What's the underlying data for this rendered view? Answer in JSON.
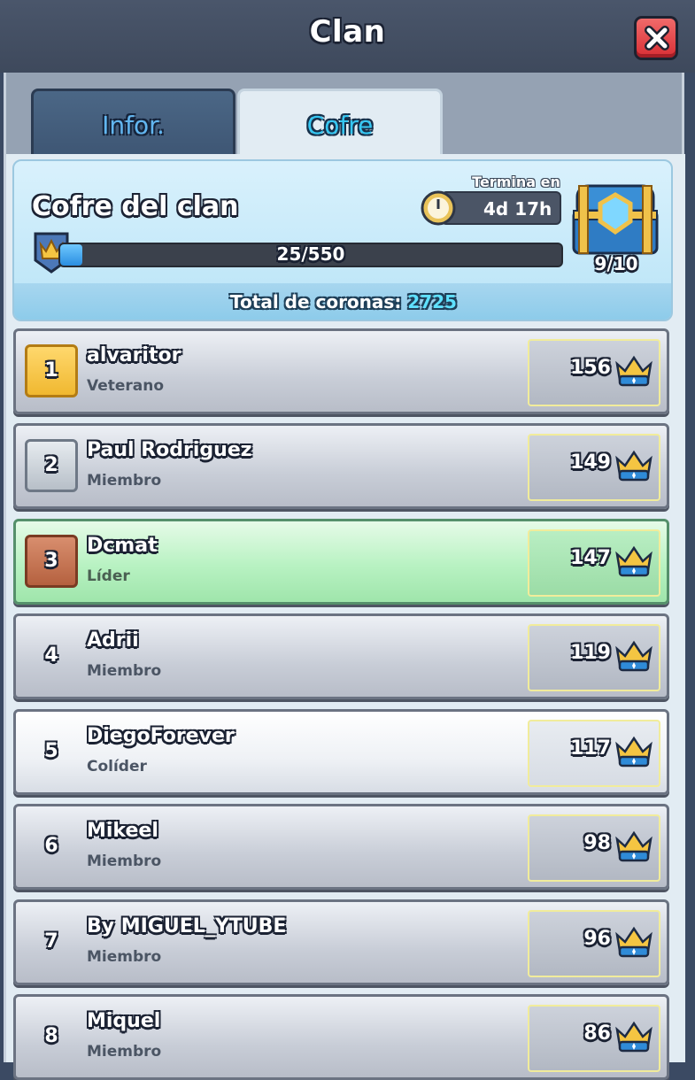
{
  "header": {
    "title": "Clan"
  },
  "tabs": [
    {
      "label": "Infor.",
      "active": false
    },
    {
      "label": "Cofre",
      "active": true
    }
  ],
  "chest": {
    "title": "Cofre del clan",
    "ends_label": "Termina en",
    "time_left": "4d 17h",
    "progress_text": "25/550",
    "progress_fraction": 0.045,
    "chest_count": "9/10",
    "total_label": "Total de coronas:",
    "total_value": "2725"
  },
  "members": [
    {
      "rank": "1",
      "name": "alvaritor",
      "role": "Veterano",
      "crowns": "156",
      "style": "gold"
    },
    {
      "rank": "2",
      "name": "Paul Rodriguez",
      "role": "Miembro",
      "crowns": "149",
      "style": "silver"
    },
    {
      "rank": "3",
      "name": "Dcmat",
      "role": "Líder",
      "crowns": "147",
      "style": "bronze"
    },
    {
      "rank": "4",
      "name": "Adrii",
      "role": "Miembro",
      "crowns": "119",
      "style": "plain"
    },
    {
      "rank": "5",
      "name": "DiegoForever",
      "role": "Colíder",
      "crowns": "117",
      "style": "plain"
    },
    {
      "rank": "6",
      "name": "Mikeel",
      "role": "Miembro",
      "crowns": "98",
      "style": "plain"
    },
    {
      "rank": "7",
      "name": "By MIGUEL_YTUBE",
      "role": "Miembro",
      "crowns": "96",
      "style": "plain"
    },
    {
      "rank": "8",
      "name": "Miquel",
      "role": "Miembro",
      "crowns": "86",
      "style": "plain"
    }
  ],
  "colors": {
    "accent_blue": "#35c7f2",
    "close_red": "#d92f35",
    "leader_green": "#b8f2c2"
  },
  "icons": {
    "close": "close-icon",
    "clock": "clock-icon",
    "crown": "crown-icon",
    "chest": "chest-icon"
  }
}
